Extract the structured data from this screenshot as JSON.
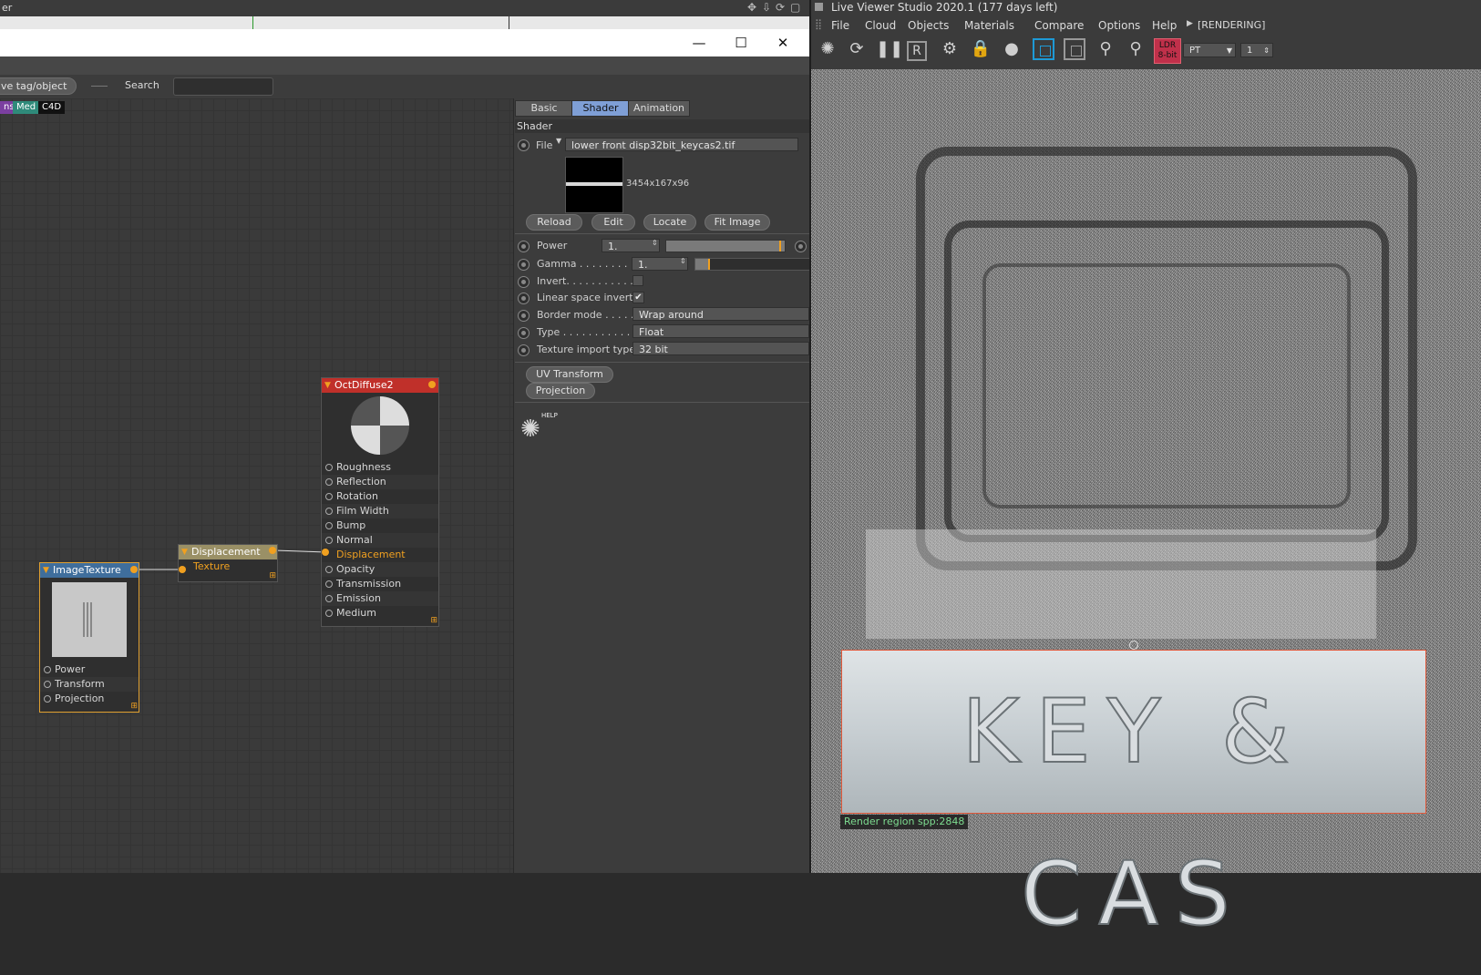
{
  "left_window": {
    "top_title_fragment": "er",
    "toolbar": {
      "object_button": "ve tag/object",
      "search_label": "Search",
      "search_value": ""
    },
    "tags": [
      {
        "label": "ns",
        "color": "#7b3fa0"
      },
      {
        "label": "Med",
        "color": "#2f8a7a"
      },
      {
        "label": "C4D",
        "color": "#111111"
      }
    ]
  },
  "nodes": {
    "image_texture": {
      "title": "ImageTexture",
      "header_color": "#3f6e9c",
      "ports": [
        "Power",
        "Transform",
        "Projection"
      ]
    },
    "displacement": {
      "title": "Displacement",
      "header_color": "#9a9066",
      "ports": [
        "Texture"
      ]
    },
    "oct_diffuse": {
      "title": "OctDiffuse2",
      "header_color": "#c0302a",
      "ports": [
        "Roughness",
        "Reflection",
        "Rotation",
        "Film Width",
        "Bump",
        "Normal",
        "Displacement",
        "Opacity",
        "Transmission",
        "Emission",
        "Medium"
      ]
    }
  },
  "attributes": {
    "tabs": [
      "Basic",
      "Shader",
      "Animation"
    ],
    "active_tab": "Shader",
    "section_title": "Shader",
    "file_label": "File",
    "file_value": "lower front disp32bit_keycas2.tif",
    "preview_size": "3454x167x96",
    "buttons": [
      "Reload",
      "Edit",
      "Locate",
      "Fit Image"
    ],
    "power": {
      "label": "Power",
      "value": "1."
    },
    "gamma": {
      "label": "Gamma . . . . . . . . . .",
      "value": "1."
    },
    "invert": {
      "label": "Invert. . . . . . . . . . . ."
    },
    "linear_space_invert": {
      "label": "Linear space invert",
      "check": "✔"
    },
    "border_mode": {
      "label": "Border mode . . . . .",
      "value": "Wrap around"
    },
    "type": {
      "label": "Type . . . . . . . . . . . .",
      "value": "Float"
    },
    "texture_import_type": {
      "label": "Texture import type",
      "value": "32 bit"
    },
    "uv_transform": "UV Transform",
    "projection": "Projection",
    "help_label": "HELP"
  },
  "viewer": {
    "title": "Live Viewer Studio 2020.1 (177 days left)",
    "menu": [
      "File",
      "Cloud",
      "Objects",
      "Materials",
      "Compare",
      "Options",
      "Help"
    ],
    "status": "[RENDERING]",
    "ldr_badge_top": "LDR",
    "ldr_badge_bottom": "8-bit",
    "kernel_select": "PT",
    "spp_input": "1",
    "render_text": "KEY & CAS",
    "region_label": "Render region spp:2848",
    "accent_colors": {
      "region_border": "#e0583a",
      "region_label_text": "#7ddc90",
      "ldr_badge": "#c0304a"
    }
  }
}
